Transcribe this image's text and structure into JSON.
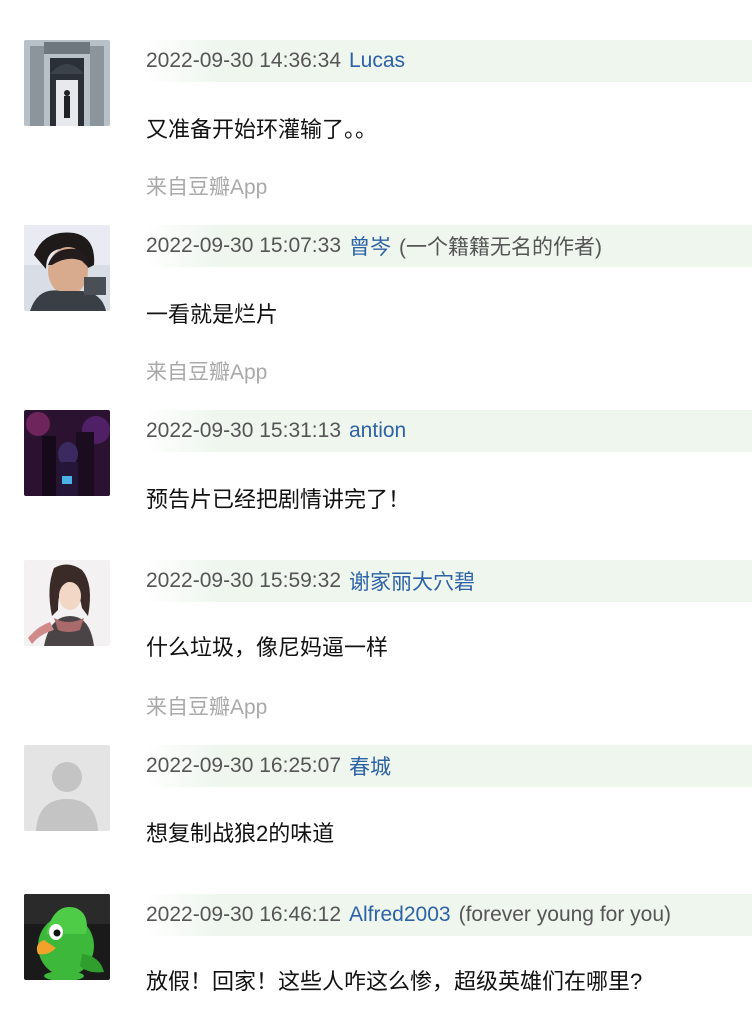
{
  "comments": [
    {
      "time": "2022-09-30 14:36:34",
      "user": "Lucas",
      "note": "",
      "text": "又准备开始环灌输了。。",
      "source": "来自豆瓣App",
      "avatar": "building-doorway-photo"
    },
    {
      "time": "2022-09-30 15:07:33",
      "user": "曾岑",
      "note": "(一个籍籍无名的作者)",
      "text": "一看就是烂片",
      "source": "来自豆瓣App",
      "avatar": "person-portrait-photo"
    },
    {
      "time": "2022-09-30 15:31:13",
      "user": "antion",
      "note": "",
      "text": "预告片已经把剧情讲完了！",
      "source": "",
      "avatar": "night-scene-photo"
    },
    {
      "time": "2022-09-30 15:59:32",
      "user": "谢家丽大穴碧",
      "note": "",
      "text": "什么垃圾，像尼妈逼一样",
      "source": "来自豆瓣App",
      "avatar": "anime-character-image"
    },
    {
      "time": "2022-09-30 16:25:07",
      "user": "春城",
      "note": "",
      "text": "想复制战狼2的味道",
      "source": "",
      "avatar": "default-user-silhouette"
    },
    {
      "time": "2022-09-30 16:46:12",
      "user": "Alfred2003",
      "note": "(forever young for you)",
      "text": "放假！回家！这些人咋这么惨，超级英雄们在哪里?",
      "source": "",
      "avatar": "green-parrot-cartoon"
    }
  ],
  "colors": {
    "username": "#2d62a6",
    "meta_background": "#eef6ee",
    "source_text": "#a9a9a9"
  }
}
